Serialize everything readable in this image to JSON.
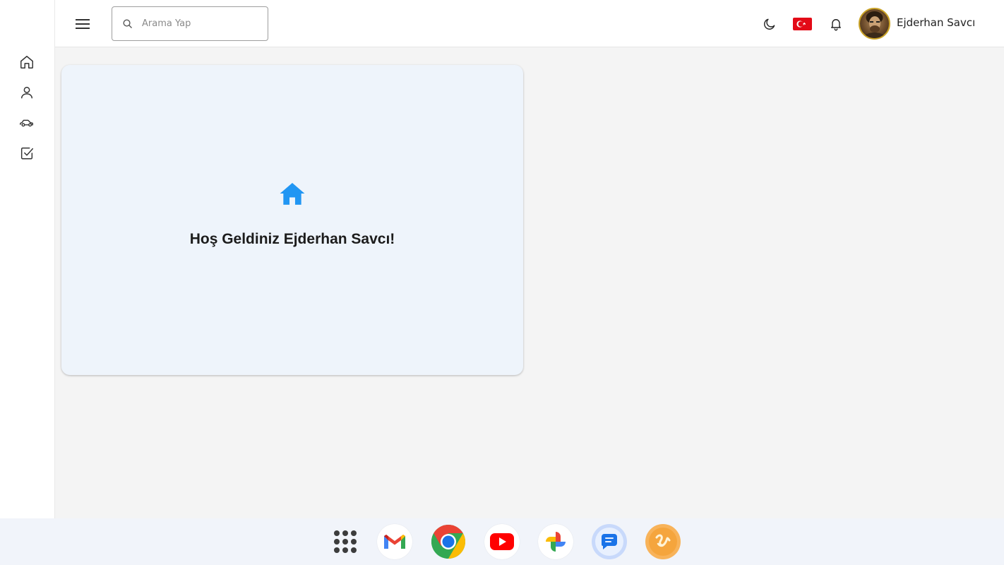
{
  "header": {
    "search_placeholder": "Arama Yap",
    "user_name": "Ejderhan Savcı"
  },
  "sidebar": {
    "items": [
      {
        "icon": "home-icon"
      },
      {
        "icon": "user-icon"
      },
      {
        "icon": "car-icon"
      },
      {
        "icon": "checkbox-icon"
      }
    ]
  },
  "main": {
    "welcome_text": "Hoş Geldiniz Ejderhan Savcı!"
  },
  "shelf": {
    "apps": [
      "launcher",
      "gmail",
      "chrome",
      "youtube",
      "photos",
      "messages",
      "app"
    ]
  },
  "colors": {
    "accent": "#2196f3",
    "card_bg": "#eef4fb",
    "flag_red": "#e30a17"
  }
}
